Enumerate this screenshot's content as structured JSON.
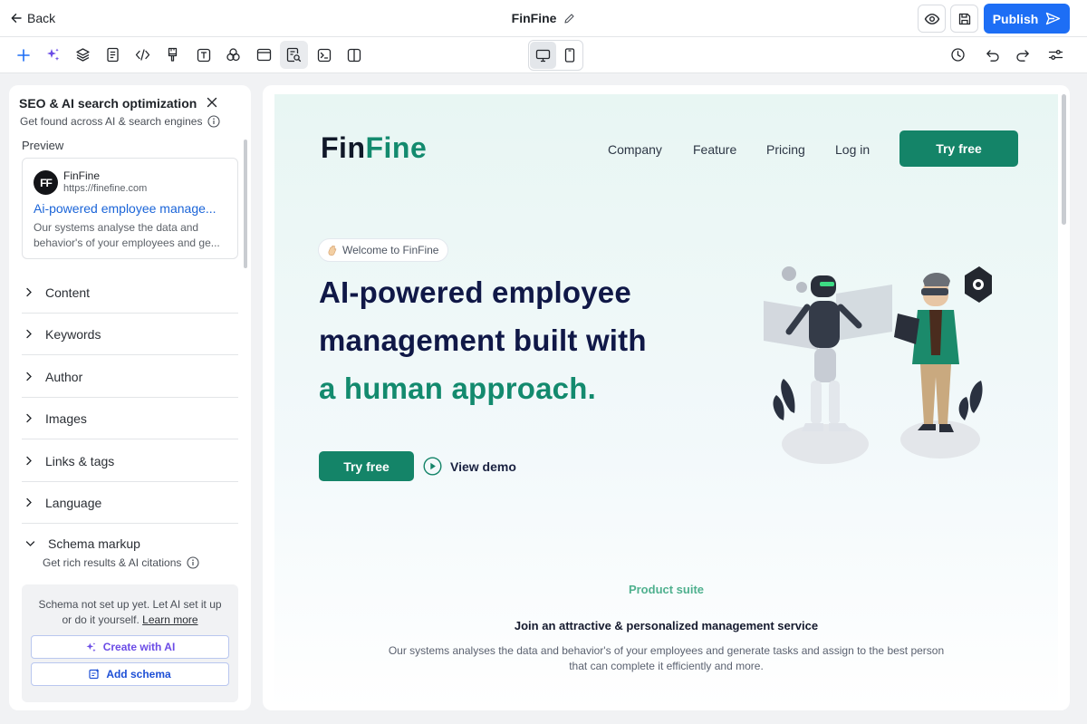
{
  "topbar": {
    "back_label": "Back",
    "doc_title": "FinFine",
    "publish_label": "Publish"
  },
  "seo_panel": {
    "title": "SEO & AI search optimization",
    "subtitle": "Get found across AI & search engines",
    "preview_label": "Preview",
    "preview_card": {
      "logo_letters": "FF",
      "site_name": "FinFine",
      "url": "https://finefine.com",
      "title": "Ai-powered employee manage...",
      "desc_line1": "Our systems analyse the data and",
      "desc_line2": "behavior's of your employees and ge..."
    },
    "sections": [
      {
        "label": "Content"
      },
      {
        "label": "Keywords"
      },
      {
        "label": "Author"
      },
      {
        "label": "Images"
      },
      {
        "label": "Links & tags"
      },
      {
        "label": "Language"
      }
    ],
    "schema": {
      "label": "Schema markup",
      "subtitle": "Get rich results & AI citations",
      "message_line1": "Schema not set up yet. Let AI set it up",
      "message_line2": "or do it yourself.",
      "learn_more": "Learn more",
      "create_ai_label": "Create with AI",
      "add_schema_label": "Add schema"
    }
  },
  "site": {
    "logo_part1": "Fin",
    "logo_part2": "Fine",
    "nav": [
      "Company",
      "Feature",
      "Pricing",
      "Log in"
    ],
    "nav_cta": "Try free",
    "welcome_badge": "Welcome to FinFine",
    "hero_line1": "AI-powered employee",
    "hero_line2": "management built with",
    "hero_line3": "a human approach.",
    "hero_cta": "Try free",
    "demo_label": "View demo",
    "suite_tag": "Product suite",
    "suite_title": "Join an attractive & personalized management service",
    "suite_desc_line1": "Our systems analyses the data and behavior's of your employees and generate tasks and assign to the best person",
    "suite_desc_line2": "that can complete it efficiently and more."
  },
  "colors": {
    "accent_blue": "#1d6ef5",
    "brand_green": "#148468",
    "link_blue": "#1a64d8",
    "ai_purple": "#6b4ce6"
  },
  "icons": {
    "toolbar": [
      "plus-icon",
      "sparkles-icon",
      "layers-icon",
      "page-icon",
      "code-icon",
      "brush-icon",
      "text-icon",
      "assets-icon",
      "layout-icon",
      "seo-icon",
      "terminal-icon",
      "columns-icon"
    ],
    "toolbar_right": [
      "history-icon",
      "undo-icon",
      "redo-icon",
      "settings-sliders-icon"
    ]
  }
}
